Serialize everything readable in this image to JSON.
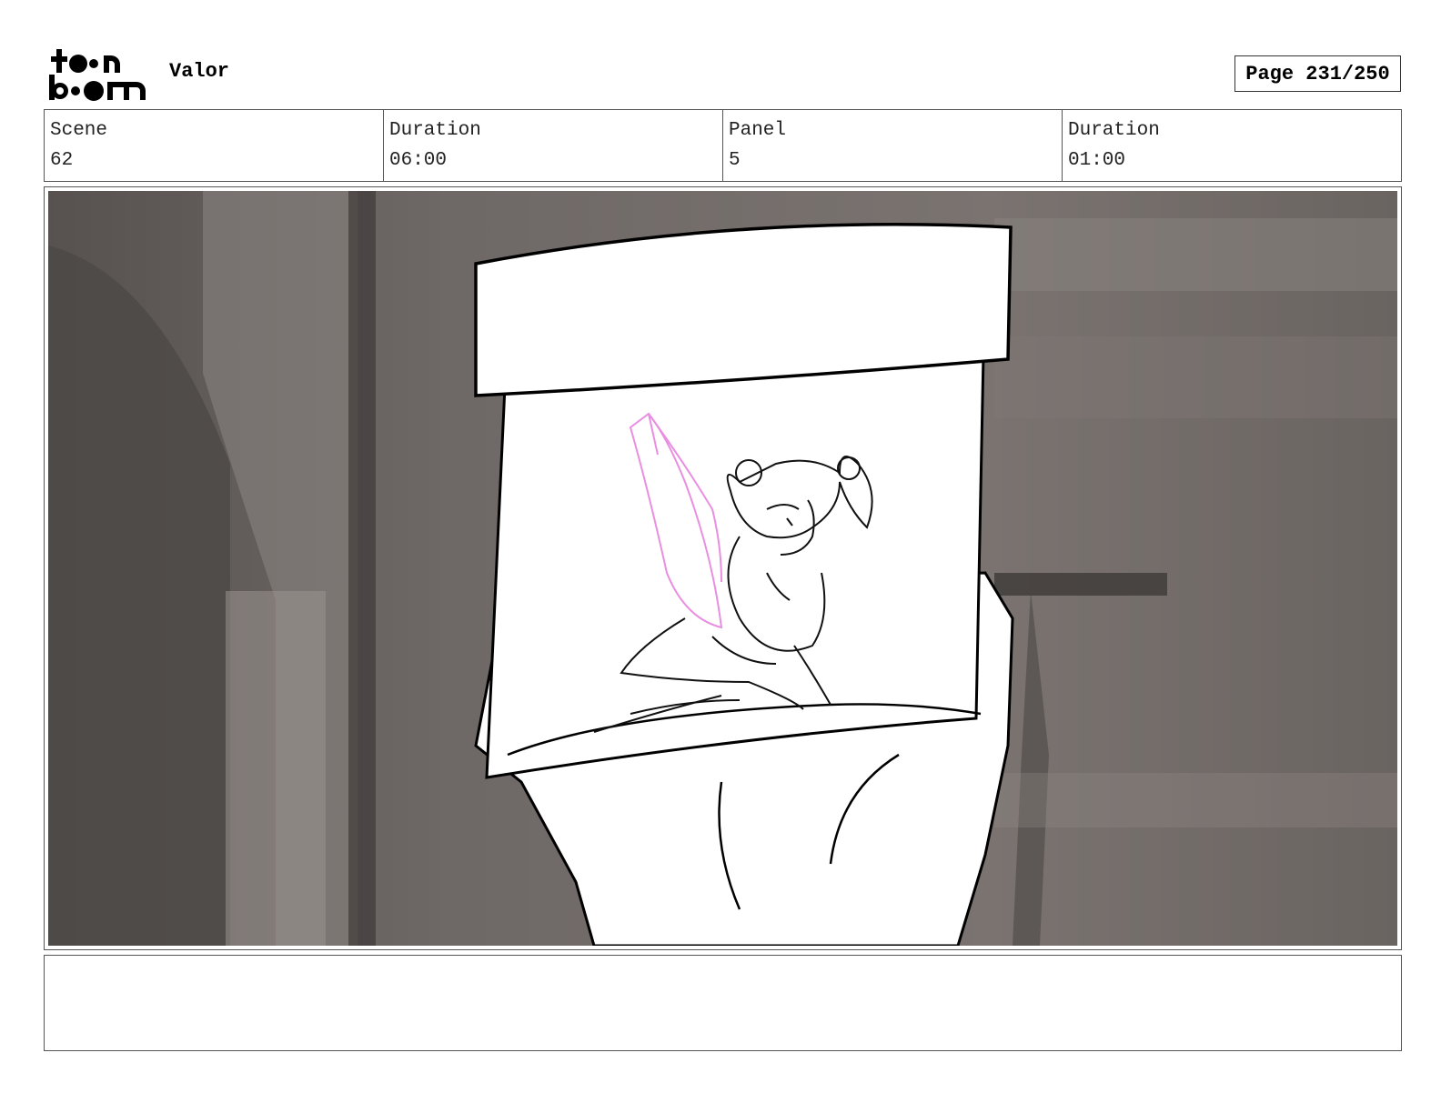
{
  "header": {
    "logo_text": "toonboom",
    "project_title": "Valor",
    "page_label": "Page 231/250"
  },
  "info": {
    "scene_label": "Scene",
    "scene_value": "62",
    "scene_duration_label": "Duration",
    "scene_duration_value": "06:00",
    "panel_label": "Panel",
    "panel_value": "5",
    "panel_duration_label": "Duration",
    "panel_duration_value": "01:00"
  },
  "notes": {
    "text": ""
  },
  "colors": {
    "wing_pink": "#e98ee0",
    "background_gray": "#6b6562"
  }
}
